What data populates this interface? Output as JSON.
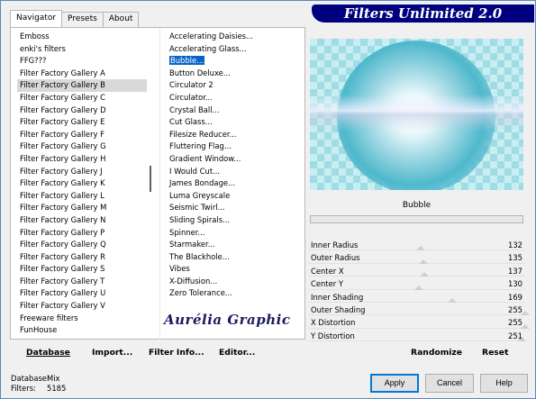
{
  "banner": {
    "title": "Filters Unlimited 2.0"
  },
  "tabs": [
    {
      "label": "Navigator",
      "active": true
    },
    {
      "label": "Presets",
      "active": false
    },
    {
      "label": "About",
      "active": false
    }
  ],
  "categories": [
    "Emboss",
    "enki's filters",
    "FFG???",
    "Filter Factory Gallery A",
    "Filter Factory Gallery B",
    "Filter Factory Gallery C",
    "Filter Factory Gallery D",
    "Filter Factory Gallery E",
    "Filter Factory Gallery F",
    "Filter Factory Gallery G",
    "Filter Factory Gallery H",
    "Filter Factory Gallery J",
    "Filter Factory Gallery K",
    "Filter Factory Gallery L",
    "Filter Factory Gallery M",
    "Filter Factory Gallery N",
    "Filter Factory Gallery P",
    "Filter Factory Gallery Q",
    "Filter Factory Gallery R",
    "Filter Factory Gallery S",
    "Filter Factory Gallery T",
    "Filter Factory Gallery U",
    "Filter Factory Gallery V",
    "Freeware filters",
    "FunHouse"
  ],
  "selected_category": "Filter Factory Gallery B",
  "filters": [
    "Accelerating Daisies...",
    "Accelerating Glass...",
    "Bubble...",
    "Button Deluxe...",
    "Circulator 2",
    "Circulator...",
    "Crystal Ball...",
    "Cut Glass...",
    "Filesize Reducer...",
    "Fluttering Flag...",
    "Gradient Window...",
    "I Would Cut...",
    "James Bondage...",
    "Luma Greyscale",
    "Seismic Twirl...",
    "Sliding Spirals...",
    "Spinner...",
    "Starmaker...",
    "The Blackhole...",
    "Vibes",
    "X-Diffusion...",
    "Zero Tolerance..."
  ],
  "selected_filter": "Bubble...",
  "watermark": "Aurélia Graphic",
  "bottom_links": {
    "database": {
      "label": "Database",
      "ul": "D",
      "rest": "atabase"
    },
    "import": {
      "label": "Import...",
      "ul": "I",
      "rest": "mport..."
    },
    "filter_info": {
      "label": "Filter Info...",
      "ul": "I"
    },
    "editor": {
      "label": "Editor...",
      "ul": "E",
      "rest": "ditor..."
    }
  },
  "preview": {
    "filter_name": "Bubble",
    "progress": 0
  },
  "sliders": [
    {
      "label": "Inner Radius",
      "value": "132",
      "max": 255
    },
    {
      "label": "Outer Radius",
      "value": "135",
      "max": 255
    },
    {
      "label": "Center X",
      "value": "137",
      "max": 255
    },
    {
      "label": "Center Y",
      "value": "130",
      "max": 255
    },
    {
      "label": "Inner Shading",
      "value": "169",
      "max": 255
    },
    {
      "label": "Outer Shading",
      "value": "255",
      "max": 255
    },
    {
      "label": "X Distortion",
      "value": "255",
      "max": 255
    },
    {
      "label": "Y Distortion",
      "value": "251",
      "max": 255
    }
  ],
  "right_buttons": {
    "randomize": "Randomize",
    "reset": "Reset"
  },
  "status": {
    "database_label": "Database:",
    "database_value": "Mix",
    "filters_label": "Filters:",
    "filters_value": "5185"
  },
  "dialog_buttons": {
    "apply": "Apply",
    "cancel": "Cancel",
    "help": "Help"
  },
  "colors": {
    "banner": "#00007f",
    "selection": "#0a64c8",
    "accent_border": "#0078d7"
  }
}
